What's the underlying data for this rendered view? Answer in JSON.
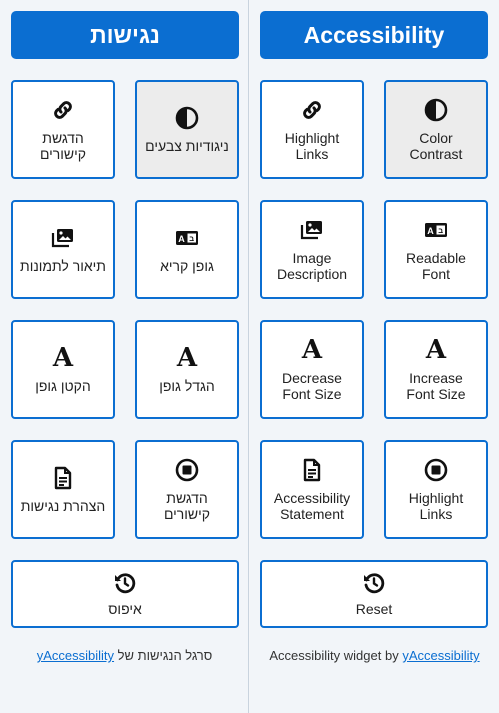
{
  "hebrew": {
    "title": "נגישות",
    "tiles": {
      "highlight_links": "הדגשת\nקישורים",
      "color_contrast": "ניגודיות צבעים",
      "image_description": "תיאור לתמונות",
      "readable_font": "גופן קריא",
      "decrease_font": "הקטן גופן",
      "increase_font": "הגדל גופן",
      "accessibility_statement": "הצהרת נגישות",
      "highlight_links_2": "הדגשת\nקישורים",
      "reset": "איפוס"
    },
    "footer_text": "סרגל הנגישות של",
    "footer_link": "yAccessibility"
  },
  "english": {
    "title": "Accessibility",
    "tiles": {
      "highlight_links": "Highlight\nLinks",
      "color_contrast": "Color\nContrast",
      "image_description": "Image\nDescription",
      "readable_font": "Readable\nFont",
      "decrease_font": "Decrease\nFont Size",
      "increase_font": "Increase\nFont Size",
      "accessibility_statement": "Accessibility\nStatement",
      "highlight_links_2": "Highlight\nLinks",
      "reset": "Reset"
    },
    "footer_text": "Accessibility widget by",
    "footer_link": "yAccessibility"
  },
  "icons": {
    "font_size_glyph": "A"
  },
  "colors": {
    "accent": "#0b6ed1",
    "active_tile": "#ececec",
    "background": "#f2f5f9"
  }
}
